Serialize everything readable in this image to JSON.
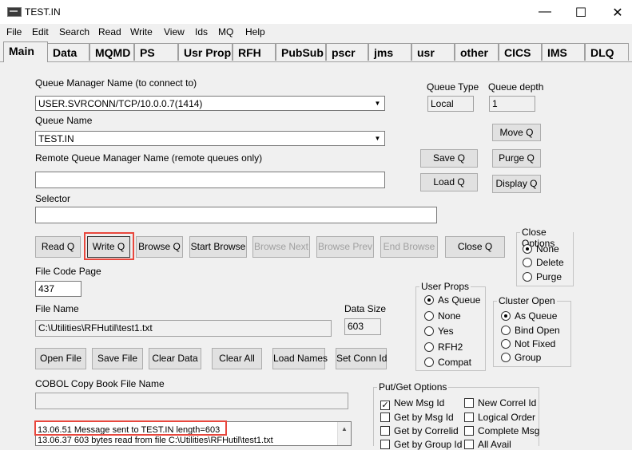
{
  "window": {
    "title": "TEST.IN",
    "minimize": "—",
    "maximize": "☐",
    "close": "✕"
  },
  "menu": [
    "File",
    "Edit",
    "Search",
    "Read",
    "Write",
    "View",
    "Ids",
    "MQ",
    "Help"
  ],
  "tabs": [
    "Main",
    "Data",
    "MQMD",
    "PS",
    "Usr Prop",
    "RFH",
    "PubSub",
    "pscr",
    "jms",
    "usr",
    "other",
    "CICS",
    "IMS",
    "DLQ"
  ],
  "main": {
    "qm_label": "Queue Manager Name (to connect to)",
    "qm_value": "USER.SVRCONN/TCP/10.0.0.7(1414)",
    "queue_type_label": "Queue Type",
    "queue_type_value": "Local",
    "queue_depth_label": "Queue depth",
    "queue_depth_value": "1",
    "queue_name_label": "Queue Name",
    "queue_name_value": "TEST.IN",
    "remote_qm_label": "Remote Queue Manager Name (remote queues only)",
    "remote_qm_value": "",
    "selector_label": "Selector",
    "selector_value": "",
    "file_code_page_label": "File Code Page",
    "file_code_page_value": "437",
    "file_name_label": "File Name",
    "file_name_value": "C:\\Utilities\\RFHutil\\test1.txt",
    "data_size_label": "Data Size",
    "data_size_value": "603",
    "cobol_label": "COBOL Copy Book File Name",
    "cobol_value": ""
  },
  "buttons": {
    "move_q": "Move Q",
    "save_q": "Save Q",
    "purge_q": "Purge Q",
    "load_q": "Load Q",
    "display_q": "Display Q",
    "read_q": "Read Q",
    "write_q": "Write Q",
    "browse_q": "Browse Q",
    "start_browse": "Start Browse",
    "browse_next": "Browse Next",
    "browse_prev": "Browse Prev",
    "end_browse": "End Browse",
    "close_q": "Close Q",
    "open_file": "Open File",
    "save_file": "Save File",
    "clear_data": "Clear Data",
    "clear_all": "Clear All",
    "load_names": "Load Names",
    "set_conn_id": "Set Conn Id"
  },
  "close_options": {
    "title": "Close Options",
    "options": [
      "None",
      "Delete",
      "Purge"
    ],
    "selected": "None"
  },
  "user_props": {
    "title": "User Props",
    "options": [
      "As Queue",
      "None",
      "Yes",
      "RFH2",
      "Compat"
    ],
    "selected": "As Queue"
  },
  "cluster_open": {
    "title": "Cluster Open",
    "options": [
      "As Queue",
      "Bind Open",
      "Not Fixed",
      "Group"
    ],
    "selected": "As Queue"
  },
  "put_get": {
    "title": "Put/Get Options",
    "left": [
      {
        "label": "New Msg Id",
        "checked": true
      },
      {
        "label": "Get by Msg Id",
        "checked": false
      },
      {
        "label": "Get by Correlid",
        "checked": false
      },
      {
        "label": "Get by Group Id",
        "checked": false
      }
    ],
    "right": [
      {
        "label": "New Correl Id",
        "checked": false
      },
      {
        "label": "Logical Order",
        "checked": false
      },
      {
        "label": "Complete Msg",
        "checked": false
      },
      {
        "label": "All Avail",
        "checked": false
      }
    ]
  },
  "log": [
    "13.06.51 Message sent to TEST.IN length=603",
    "13.06.37 603 bytes read from file C:\\Utilities\\RFHutil\\test1.txt"
  ],
  "colors": {
    "highlight": "#e8473d"
  }
}
